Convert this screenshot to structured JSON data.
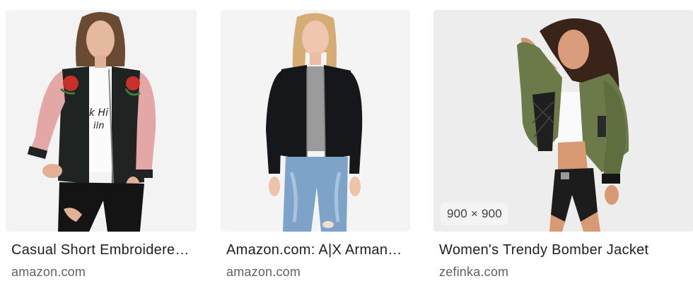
{
  "results": [
    {
      "title": "Casual Short Embroidere…",
      "source": "amazon.com",
      "image_alt_icon": "woman-in-pink-sleeve-floral-bomber-jacket-photo"
    },
    {
      "title": "Amazon.com: A|X Arman…",
      "source": "amazon.com",
      "image_alt_icon": "woman-in-black-bomber-jacket-photo"
    },
    {
      "title": "Women's Trendy Bomber Jacket",
      "source": "zefinka.com",
      "dimensions": "900 × 900",
      "image_alt_icon": "woman-in-olive-bomber-jacket-photo"
    }
  ],
  "colors": {
    "title_text": "#202124",
    "source_text": "#5f6368",
    "photo_background": "#f2f2f2"
  }
}
